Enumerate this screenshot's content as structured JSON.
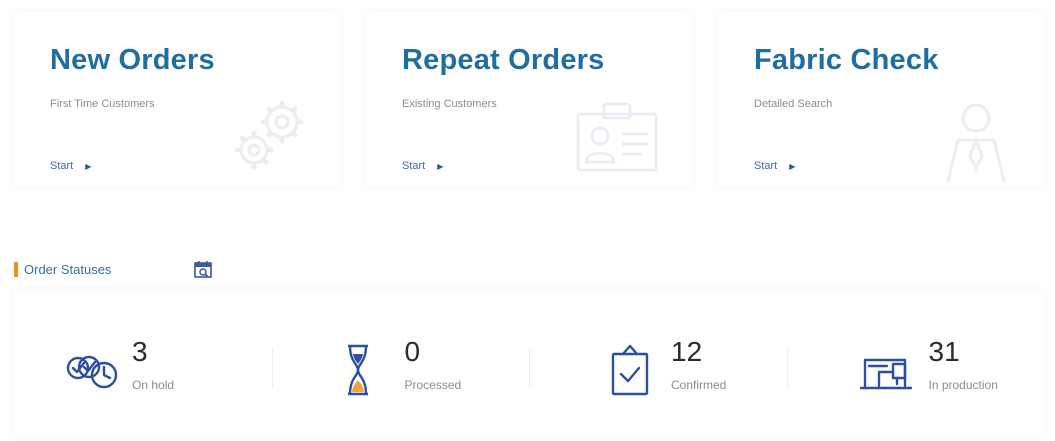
{
  "cards": [
    {
      "title": "New Orders",
      "subtitle": "First Time Customers",
      "action": "Start",
      "icon": "gears-icon"
    },
    {
      "title": "Repeat Orders",
      "subtitle": "Existing Customers",
      "action": "Start",
      "icon": "id-card-icon"
    },
    {
      "title": "Fabric Check",
      "subtitle": "Detailed Search",
      "action": "Start",
      "icon": "person-icon"
    }
  ],
  "order_statuses": {
    "title": "Order Statuses",
    "items": [
      {
        "count": "3",
        "label": "On hold",
        "icon": "checks-clock-icon"
      },
      {
        "count": "0",
        "label": "Processed",
        "icon": "hourglass-icon"
      },
      {
        "count": "12",
        "label": "Confirmed",
        "icon": "clipboard-check-icon"
      },
      {
        "count": "31",
        "label": "In production",
        "icon": "sewing-machine-icon"
      }
    ]
  },
  "colors": {
    "title_blue": "#1f6ea2",
    "accent_orange": "#f28c1b",
    "icon_blue": "#2c4f9e"
  }
}
